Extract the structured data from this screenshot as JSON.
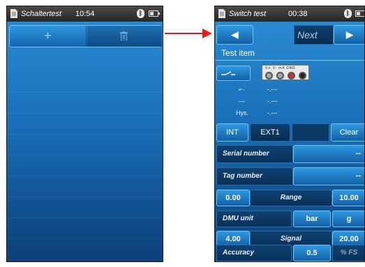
{
  "left_screen": {
    "status": {
      "title": "Schaltertest",
      "time": "10:54"
    },
    "toolbar": {
      "add_label": "+"
    }
  },
  "right_screen": {
    "status": {
      "title": "Switch test",
      "time": "00:38"
    },
    "nav": {
      "prev_icon": "◀",
      "next_label": "Next",
      "next_icon": "▶"
    },
    "section_title": "Test item",
    "connector_labels": "V+ V- mA GND",
    "states": [
      {
        "symbol": "⌐·",
        "value": "-.---"
      },
      {
        "symbol": "—",
        "value": "-.---"
      },
      {
        "symbol": "Hys.",
        "value": "-.---"
      }
    ],
    "tabs": {
      "int": "INT",
      "ext1": "EXT1",
      "clear": "Clear"
    },
    "serial_number": {
      "label": "Serial number",
      "value": "--"
    },
    "tag_number": {
      "label": "Tag number",
      "value": "--"
    },
    "range": {
      "min": "0.00",
      "label": "Range",
      "max": "10.00"
    },
    "dmu_unit": {
      "label": "DMU unit",
      "unit": "bar",
      "alt_unit": "g"
    },
    "signal": {
      "min": "4.00",
      "label": "Signal",
      "max": "20.00"
    },
    "accuracy": {
      "label": "Accuracy",
      "value": "0.5",
      "unit": "% FS"
    }
  },
  "colors": {
    "arrow": "#e02020",
    "screen_bg": "#1a6fb8"
  },
  "icons": [
    "document-icon",
    "bluetooth-icon",
    "battery-icon",
    "trash-icon",
    "plus-icon",
    "arrow-left-icon",
    "arrow-right-icon",
    "switch-icon",
    "connector-icon"
  ]
}
